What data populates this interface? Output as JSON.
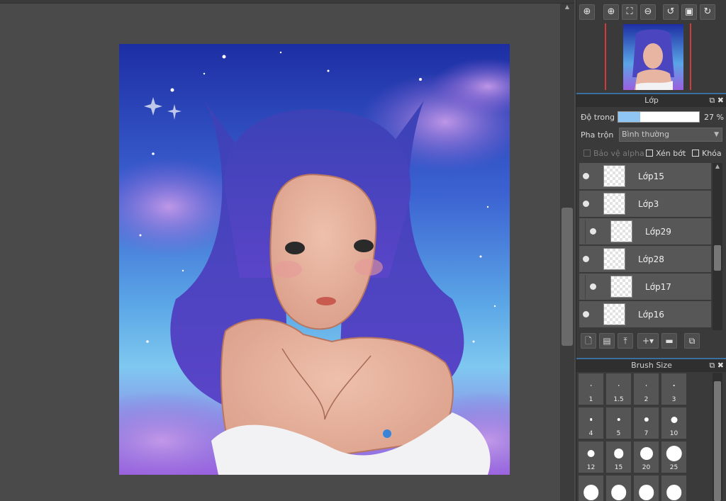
{
  "nav_toolbar": {
    "icons": [
      "zoom-in-icon",
      "zoom-in-plus-icon",
      "fit-icon",
      "zoom-out-icon",
      "rotate-left-icon",
      "fullscreen-icon",
      "rotate-right-icon"
    ]
  },
  "layer_panel": {
    "title": "Lớp",
    "opacity_label": "Độ trong",
    "opacity_value": "27 %",
    "opacity_fraction": 0.27,
    "blend_label": "Pha trộn",
    "blend_value": "Bình thường",
    "protect_alpha": "Bảo vệ alpha",
    "clipping": "Xén bớt",
    "lock": "Khóa",
    "layers": [
      {
        "name": "Lớp15",
        "clipped": false
      },
      {
        "name": "Lớp3",
        "clipped": false
      },
      {
        "name": "Lớp29",
        "clipped": true
      },
      {
        "name": "Lớp28",
        "clipped": false
      },
      {
        "name": "Lớp17",
        "clipped": true
      },
      {
        "name": "Lớp16",
        "clipped": false
      }
    ],
    "tool_icons": [
      "new-layer-icon",
      "new-layer-alt-icon",
      "import-layer-icon",
      "add-layer-menu-icon",
      "folder-icon",
      "duplicate-icon"
    ]
  },
  "brush_panel": {
    "title": "Brush Size",
    "sizes": [
      "1",
      "1.5",
      "2",
      "3",
      "4",
      "5",
      "7",
      "10",
      "12",
      "15",
      "20",
      "25",
      "",
      "",
      "",
      ""
    ]
  },
  "colors": {
    "accent": "#3b6fa0",
    "opacity_fill": "#8ec5f3",
    "navigator_border": "#d23b3b"
  }
}
